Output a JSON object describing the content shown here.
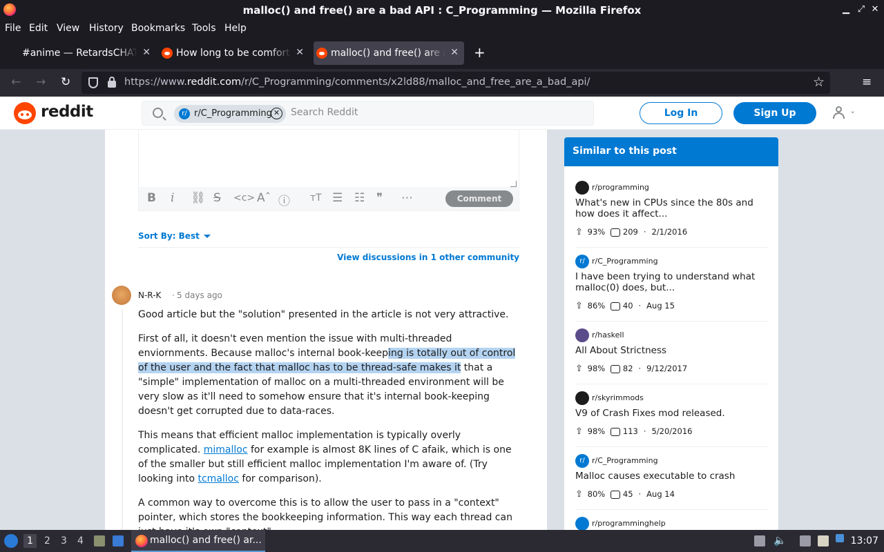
{
  "window": {
    "title": "malloc() and free() are a bad API : C_Programming — Mozilla Firefox"
  },
  "menu": [
    "File",
    "Edit",
    "View",
    "History",
    "Bookmarks",
    "Tools",
    "Help"
  ],
  "tabs": [
    {
      "label": "#anime — RetardsCHAT",
      "active": false
    },
    {
      "label": "How long to be comforta",
      "active": false
    },
    {
      "label": "malloc() and free() are a",
      "active": true
    }
  ],
  "url": {
    "prefix": "https://www.",
    "domain": "reddit.com",
    "path": "/r/C_Programming/comments/x2ld88/malloc_and_free_are_a_bad_api/"
  },
  "reddit": {
    "wordmark": "reddit",
    "search_chip": "r/C_Programming",
    "search_placeholder": "Search Reddit",
    "login": "Log In",
    "signup": "Sign Up",
    "brand_color": "#ff4500",
    "accent_color": "#0079d3"
  },
  "editor": {
    "comment_button": "Comment"
  },
  "sort": {
    "label": "Sort By: Best",
    "view_discussions": "View discussions in 1 other community"
  },
  "comment": {
    "author": "N-R-K",
    "separator": "·",
    "time": "5 days ago",
    "p1": "Good article but the \"solution\" presented in the article is not very attractive.",
    "p2a": "First of all, it doesn't even mention the issue with multi-threaded enviornments. Because malloc's internal book-keep",
    "p2hl": "ing is totally out of control of the user and the fact that malloc has to be thread-safe makes it",
    "p2b": " that a \"simple\" implementation of malloc on a multi-threaded environment will be very slow as it'll need to somehow ensure that it's internal book-keeping doesn't get corrupted due to data-races.",
    "p3a": "This means that efficient malloc implementation is typically overly complicated. ",
    "p3link1": "mimalloc",
    "p3b": " for example is almost 8K lines of C afaik, which is one of the smaller but still efficient malloc implementation I'm aware of. (Try looking into ",
    "p3link2": "tcmalloc",
    "p3c": " for comparison).",
    "p4": "A common way to overcome this is to allow the user to pass in a \"context\" pointer, which stores the bookkeeping information. This way each thread can just have it's own \"context\"."
  },
  "sidebar": {
    "heading": "Similar to this post",
    "items": [
      {
        "sub": "r/programming",
        "title": "What's new in CPUs since the 80s and how does it affect...",
        "pct": "93%",
        "comments": "209",
        "date": "2/1/2016"
      },
      {
        "sub": "r/C_Programming",
        "title": "I have been trying to understand what malloc(0) does, but...",
        "pct": "86%",
        "comments": "40",
        "date": "Aug 15"
      },
      {
        "sub": "r/haskell",
        "title": "All About Strictness",
        "pct": "98%",
        "comments": "82",
        "date": "9/12/2017"
      },
      {
        "sub": "r/skyrimmods",
        "title": "V9 of Crash Fixes mod released.",
        "pct": "98%",
        "comments": "113",
        "date": "5/20/2016"
      },
      {
        "sub": "r/C_Programming",
        "title": "Malloc causes executable to crash",
        "pct": "80%",
        "comments": "45",
        "date": "Aug 14"
      },
      {
        "sub": "r/programminghelp",
        "title": ""
      }
    ]
  },
  "taskbar": {
    "workspaces": [
      "1",
      "2",
      "3",
      "4"
    ],
    "app_label": "malloc() and free() ar...",
    "clock": "13:07"
  }
}
